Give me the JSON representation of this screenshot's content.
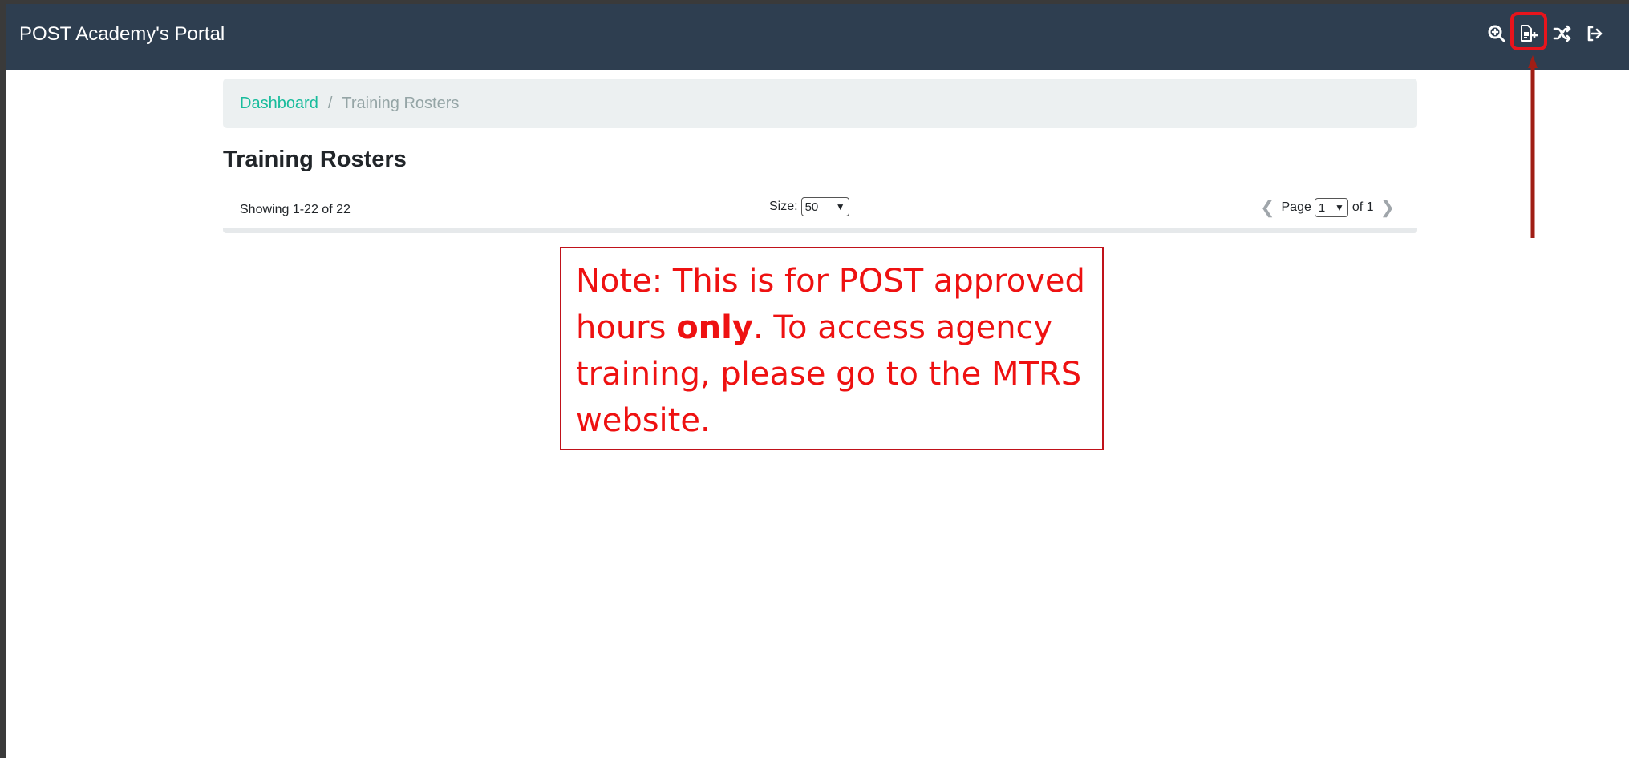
{
  "app": {
    "title": "POST Academy's Portal"
  },
  "nav_icons": [
    {
      "name": "search-zoom-icon"
    },
    {
      "name": "file-add-icon"
    },
    {
      "name": "shuffle-icon"
    },
    {
      "name": "logout-icon"
    }
  ],
  "breadcrumb": {
    "home": "Dashboard",
    "separator": "/",
    "current": "Training Rosters"
  },
  "page": {
    "title": "Training Rosters"
  },
  "list": {
    "showing": "Showing 1-22 of 22",
    "size_label": "Size:",
    "size_value": "50",
    "page_label": "Page",
    "page_value": "1",
    "of_label": "of 1"
  },
  "annotation": {
    "note_before": "Note: This is for POST approved hours ",
    "note_bold": "only",
    "note_after": ". To access agency training, please go to the MTRS website."
  },
  "colors": {
    "navbar": "#2e3e50",
    "accent": "#18bc9c",
    "annotation_red": "#ee1111"
  }
}
